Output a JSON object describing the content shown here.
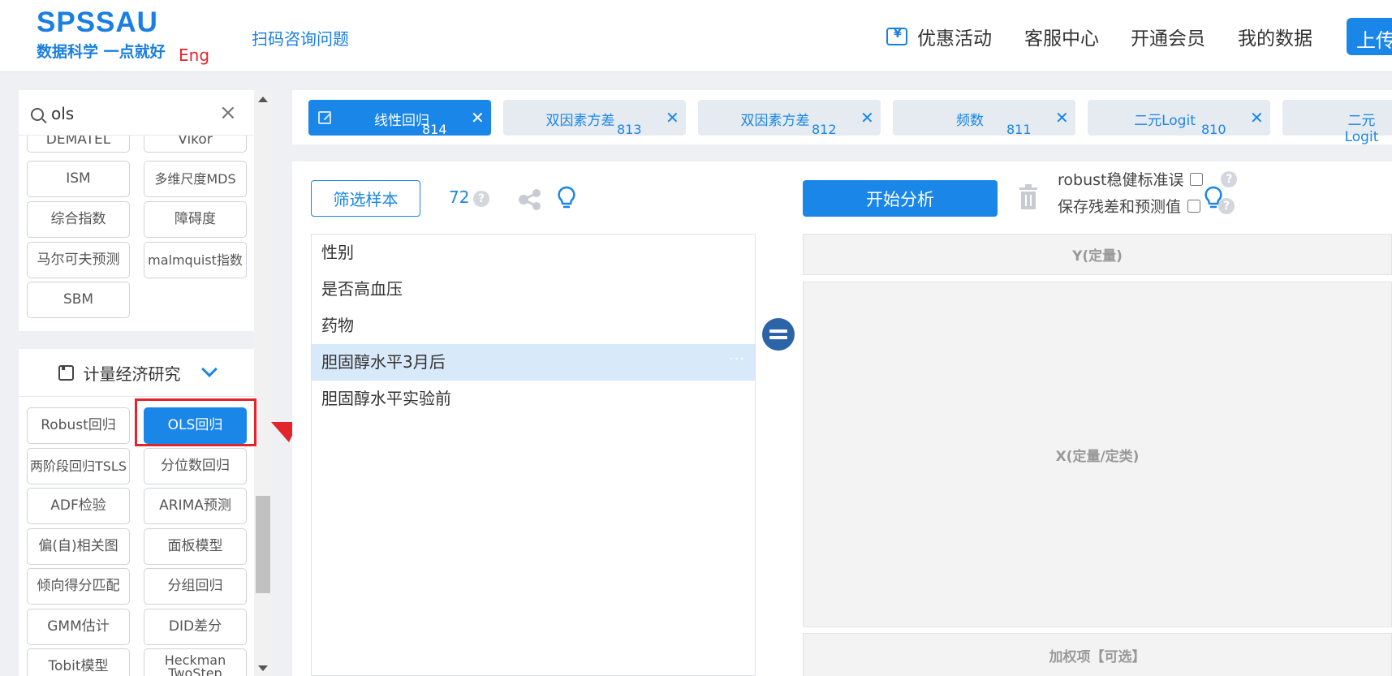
{
  "header": {
    "logo_main": "SPSSAU",
    "logo_sub": "数据科学 一点就好",
    "logo_eng": "Eng",
    "scan_link": "扫码咨询问题",
    "nav": {
      "promo": "优惠活动",
      "service": "客服中心",
      "member": "开通会员",
      "mydata": "我的数据",
      "upload": "上传"
    }
  },
  "sidebar": {
    "search": {
      "value": "ols",
      "placeholder": ""
    },
    "top_methods": [
      "DEMATEL",
      "Vikor",
      "ISM",
      "多维尺度MDS",
      "综合指数",
      "障碍度",
      "马尔可夫预测",
      "malmquist指数",
      "SBM"
    ],
    "section_title": "计量经济研究",
    "econ_methods": [
      "Robust回归",
      "OLS回归",
      "两阶段回归TSLS",
      "分位数回归",
      "ADF检验",
      "ARIMA预测",
      "偏(自)相关图",
      "面板模型",
      "倾向得分匹配",
      "分组回归",
      "GMM估计",
      "DID差分",
      "Tobit模型",
      "Heckman TwoStep"
    ],
    "active_method": "OLS回归"
  },
  "tabs": [
    {
      "label": "线性回归",
      "num": "814",
      "active": true
    },
    {
      "label": "双因素方差",
      "num": "813",
      "active": false
    },
    {
      "label": "双因素方差",
      "num": "812",
      "active": false
    },
    {
      "label": "频数",
      "num": "811",
      "active": false
    },
    {
      "label": "二元Logit",
      "num": "810",
      "active": false
    },
    {
      "label": "二元Logit",
      "num": "",
      "active": false
    }
  ],
  "main": {
    "filter_label": "筛选样本",
    "count": "72",
    "variables": [
      "性别",
      "是否高血压",
      "药物",
      "胆固醇水平3月后",
      "胆固醇水平实验前"
    ],
    "selected_variable": "胆固醇水平3月后",
    "more_dots": "···",
    "start_label": "开始分析",
    "robust_label": "robust稳健标准误",
    "save_label": "保存残差和预测值",
    "y_zone": "Y(定量)",
    "x_zone": "X(定量/定类)",
    "weight_zone": "加权项【可选】"
  },
  "colors": {
    "accent": "#1a86e8",
    "highlight": "#e3242b",
    "selected_row": "#d8e9fa"
  }
}
